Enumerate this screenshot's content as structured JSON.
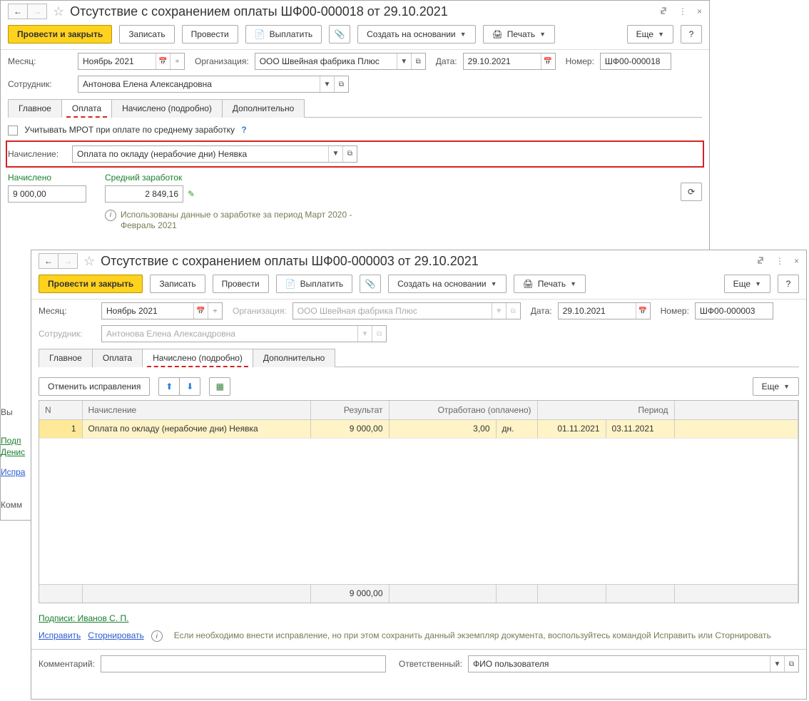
{
  "w1": {
    "title": "Отсутствие с сохранением оплаты ШФ00-000018 от 29.10.2021",
    "toolbar": {
      "primary": "Провести и закрыть",
      "write": "Записать",
      "post": "Провести",
      "pay": "Выплатить",
      "create_from": "Создать на основании",
      "print": "Печать",
      "more": "Еще"
    },
    "labels": {
      "month": "Месяц:",
      "org": "Организация:",
      "date": "Дата:",
      "number": "Номер:",
      "employee": "Сотрудник:",
      "accrual": "Начисление:"
    },
    "fields": {
      "month": "Ноябрь 2021",
      "org": "ООО Швейная фабрика Плюс",
      "date": "29.10.2021",
      "number": "ШФ00-000018",
      "employee": "Антонова Елена Александровна",
      "accrual": "Оплата по окладу (нерабочие дни) Неявка"
    },
    "tabs": {
      "t1": "Главное",
      "t2": "Оплата",
      "t3": "Начислено (подробно)",
      "t4": "Дополнительно"
    },
    "pay_tab": {
      "mrot": "Учитывать МРОТ при оплате по среднему заработку",
      "accrued_lbl": "Начислено",
      "accrued_val": "9 000,00",
      "avg_lbl": "Средний заработок",
      "avg_val": "2 849,16",
      "note": "Использованы данные о заработке за период Март 2020 - Февраль 2021"
    },
    "vy": "Вы",
    "podp": "Подп",
    "denis": "Денис",
    "ispr": "Испра",
    "comm": "Комм"
  },
  "w2": {
    "title": "Отсутствие с сохранением оплаты ШФ00-000003 от 29.10.2021",
    "toolbar": {
      "primary": "Провести и закрыть",
      "write": "Записать",
      "post": "Провести",
      "pay": "Выплатить",
      "create_from": "Создать на основании",
      "print": "Печать",
      "more": "Еще"
    },
    "labels": {
      "month": "Месяц:",
      "org": "Организация:",
      "date": "Дата:",
      "number": "Номер:",
      "employee": "Сотрудник:"
    },
    "fields": {
      "month": "Ноябрь 2021",
      "org": "ООО Швейная фабрика Плюс",
      "date": "29.10.2021",
      "number": "ШФ00-000003",
      "employee": "Антонова Елена Александровна"
    },
    "tabs": {
      "t1": "Главное",
      "t2": "Оплата",
      "t3": "Начислено (подробно)",
      "t4": "Дополнительно"
    },
    "table_toolbar": {
      "undo": "Отменить исправления",
      "more": "Еще"
    },
    "table": {
      "head": {
        "n": "N",
        "accr": "Начисление",
        "res": "Результат",
        "work": "Отработано (оплачено)",
        "period": "Период"
      },
      "row": {
        "n": "1",
        "accr": "Оплата по окладу (нерабочие дни) Неявка",
        "res": "9 000,00",
        "work": "3,00",
        "unit": "дн.",
        "d1": "01.11.2021",
        "d2": "03.11.2021"
      },
      "total": "9 000,00"
    },
    "sign": "Подписи: Иванов С. П.",
    "fix": "Исправить",
    "storno": "Сторнировать",
    "fix_note": "Если необходимо внести исправление, но при этом сохранить данный экземпляр документа, воспользуйтесь командой Исправить или Сторнировать",
    "comment_lbl": "Комментарий:",
    "resp_lbl": "Ответственный:",
    "resp_val": "ФИО пользователя"
  }
}
